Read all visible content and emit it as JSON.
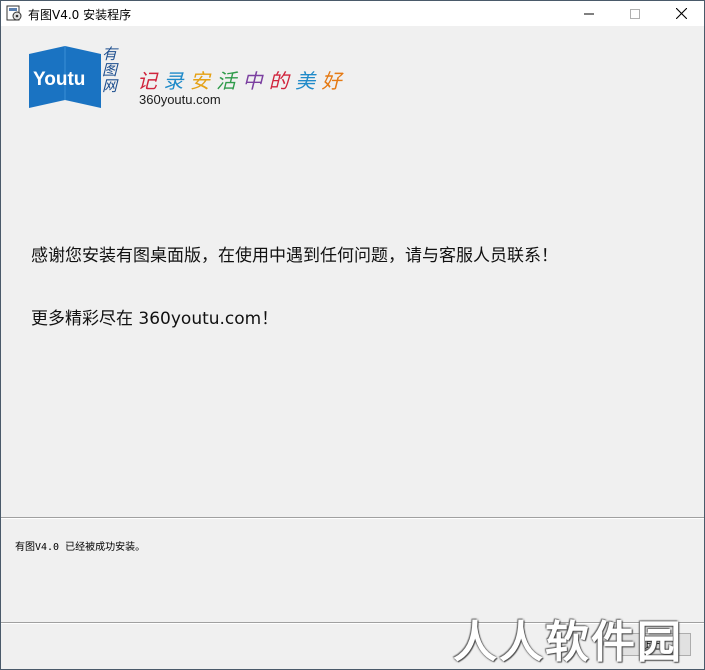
{
  "window": {
    "title": "有图V4.0 安装程序",
    "min_glyph": "—",
    "max_glyph": "☐",
    "close_glyph": "✕",
    "icons": {
      "app": "installer-icon",
      "minimize": "minimize-icon",
      "maximize": "maximize-icon",
      "close": "close-icon"
    }
  },
  "branding": {
    "logo_text": "Youtu",
    "logo_cn": [
      "有",
      "图",
      "网"
    ],
    "slogan_chars": [
      "记",
      "录",
      "安",
      "活",
      "中",
      "的",
      "美",
      "好"
    ],
    "slogan_colors": [
      "#d0243c",
      "#1f8ac9",
      "#e5a114",
      "#2e9b4a",
      "#7b3fa0",
      "#d0243c",
      "#1f8ac9",
      "#e57a14"
    ],
    "site": "360youtu.com",
    "logo_color": "#1a73c2"
  },
  "content": {
    "message1": "感谢您安装有图桌面版，在使用中遇到任何问题，请与客服人员联系！",
    "message2": "更多精彩尽在 360youtu.com！"
  },
  "status": {
    "text": "有图V4.0 已经被成功安装。"
  },
  "buttons": {
    "back_label": "退出"
  },
  "watermark": {
    "text": "人人软件园"
  }
}
